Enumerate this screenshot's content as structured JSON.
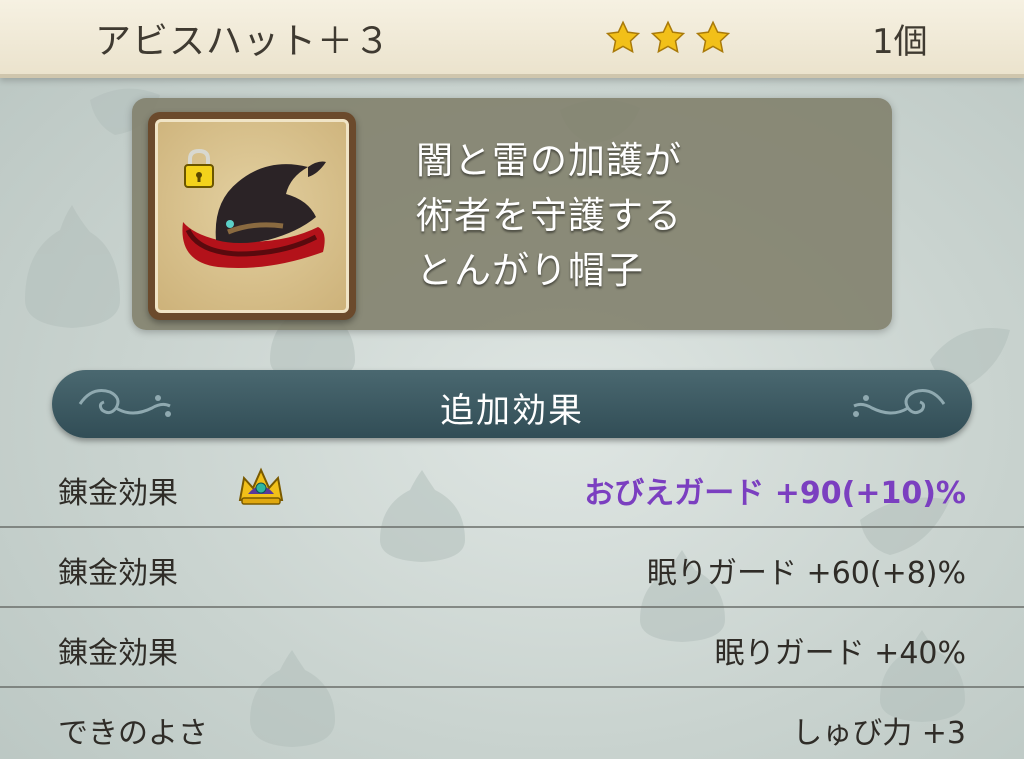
{
  "header": {
    "title": "アビスハット＋３",
    "star_count": 3,
    "quantity": "1個"
  },
  "item": {
    "icon": "abyss-hat-icon",
    "lock_icon": "padlock-icon",
    "description": [
      "闇と雷の加護が",
      "術者を守護する",
      "とんがり帽子"
    ]
  },
  "section": {
    "title": "追加効果"
  },
  "rows": [
    {
      "label": "錬金効果",
      "value": "おびえガード +90(+10)%",
      "value_color": "#7b3fc0",
      "icon": "crown-icon"
    },
    {
      "label": "錬金効果",
      "value": "眠りガード +60(+8)%",
      "value_color": "#2f2c27"
    },
    {
      "label": "錬金効果",
      "value": "眠りガード +40%",
      "value_color": "#2f2c27"
    },
    {
      "label": "できのよさ",
      "value": "しゅび力 +3",
      "value_color": "#2f2c27"
    }
  ],
  "colors": {
    "star": "#f2c019",
    "section_bar": "#3c5a63",
    "highlight_value": "#7b3fc0"
  }
}
